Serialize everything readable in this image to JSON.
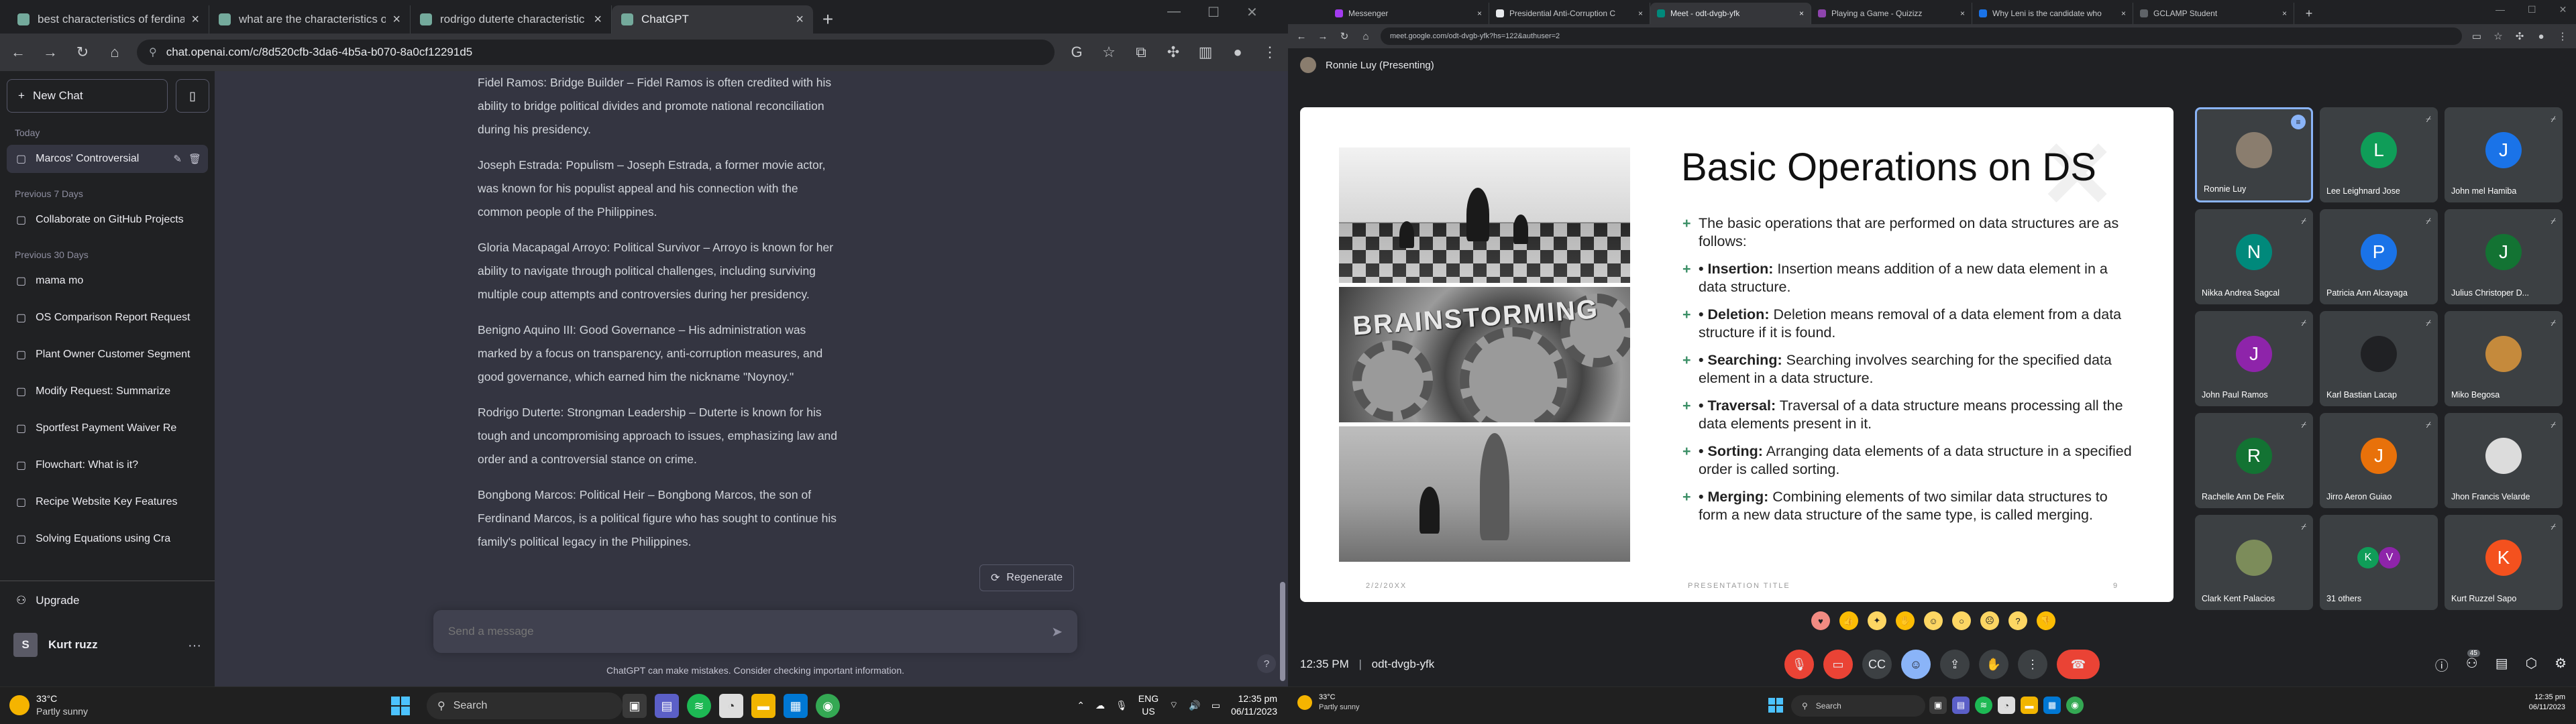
{
  "left_browser": {
    "tabs": [
      {
        "title": "best characteristics of ferdinan",
        "color": "#74aa9c"
      },
      {
        "title": "what are the characteristics of",
        "color": "#74aa9c"
      },
      {
        "title": "rodrigo duterte characteristic",
        "color": "#74aa9c"
      },
      {
        "title": "ChatGPT",
        "color": "#74aa9c"
      }
    ],
    "url": "chat.openai.com/c/8d520cfb-3da6-4b5a-b070-8a0cf12291d5"
  },
  "chatgpt": {
    "new_chat": "New Chat",
    "sections": [
      {
        "label": "Today",
        "items": [
          "Marcos' Controversial"
        ]
      },
      {
        "label": "Previous 7 Days",
        "items": [
          "Collaborate on GitHub Projects"
        ]
      },
      {
        "label": "Previous 30 Days",
        "items": [
          "mama mo",
          "OS Comparison Report Request",
          "Plant Owner Customer Segment",
          "Modify Request: Summarize",
          "Sportfest Payment Waiver Re",
          "Flowchart: What is it?",
          "Recipe Website Key Features",
          "Solving Equations using Cra"
        ]
      }
    ],
    "upgrade": "Upgrade",
    "user_initial": "S",
    "user_name": "Kurt ruzz",
    "messages": [
      "Fidel Ramos: Bridge Builder – Fidel Ramos is often credited with his ability to bridge political divides and promote national reconciliation during his presidency.",
      "Joseph Estrada: Populism – Joseph Estrada, a former movie actor, was known for his populist appeal and his connection with the common people of the Philippines.",
      "Gloria Macapagal Arroyo: Political Survivor – Arroyo is known for her ability to navigate through political challenges, including surviving multiple coup attempts and controversies during her presidency.",
      "Benigno Aquino III: Good Governance – His administration was marked by a focus on transparency, anti-corruption measures, and good governance, which earned him the nickname \"Noynoy.\"",
      "Rodrigo Duterte: Strongman Leadership – Duterte is known for his tough and uncompromising approach to issues, emphasizing law and order and a controversial stance on crime.",
      "Bongbong Marcos: Political Heir – Bongbong Marcos, the son of Ferdinand Marcos, is a political figure who has sought to continue his family's political legacy in the Philippines."
    ],
    "regenerate": "Regenerate",
    "input_placeholder": "Send a message",
    "disclaimer": "ChatGPT can make mistakes. Consider checking important information.",
    "help": "?"
  },
  "left_taskbar": {
    "temp": "33°C",
    "weather": "Partly sunny",
    "search": "Search",
    "lang1": "ENG",
    "lang2": "US",
    "time": "12:35 pm",
    "date": "06/11/2023"
  },
  "right_browser": {
    "tabs": [
      {
        "title": "Messenger",
        "color": "#a33bf0"
      },
      {
        "title": "Presidential Anti-Corruption C",
        "color": "#e8eaed"
      },
      {
        "title": "Meet - odt-dvgb-yfk",
        "color": "#00897b"
      },
      {
        "title": "Playing a Game - Quizizz",
        "color": "#8e44ad"
      },
      {
        "title": "Why Leni is the candidate who",
        "color": "#1a73e8"
      },
      {
        "title": "GCLAMP Student",
        "color": "#5f6368"
      }
    ],
    "url": "meet.google.com/odt-dvgb-yfk?hs=122&authuser=2"
  },
  "meet": {
    "presenter_label": "Ronnie Luy (Presenting)",
    "slide": {
      "title": "Basic Operations on DS",
      "bullets": [
        {
          "term": "",
          "text": "The basic operations that are performed on data structures are as follows:"
        },
        {
          "term": "• Insertion:",
          "text": " Insertion means addition of a new data element in a data structure."
        },
        {
          "term": "• Deletion:",
          "text": " Deletion means removal of a data element from a data structure if it is found."
        },
        {
          "term": "• Searching:",
          "text": " Searching involves searching for the specified data element in a data structure."
        },
        {
          "term": "• Traversal:",
          "text": " Traversal of a data structure means processing all the data elements present in it."
        },
        {
          "term": "• Sorting:",
          "text": " Arranging data elements of a data structure in a specified order is called sorting."
        },
        {
          "term": "• Merging:",
          "text": " Combining elements of two similar data structures to form a new data structure of the same type, is called merging."
        }
      ],
      "image_word": "BRAINSTORMING",
      "footer_date": "2/2/20XX",
      "footer_title": "PRESENTATION TITLE",
      "footer_page": "9"
    },
    "participants": [
      {
        "name": "Ronnie Luy",
        "initial": "",
        "color": "#8a7d6e",
        "photo": true,
        "active": true
      },
      {
        "name": "Lee Leighnard Jose",
        "initial": "L",
        "color": "#0f9d58"
      },
      {
        "name": "John mel Hamiba",
        "initial": "J",
        "color": "#1a73e8"
      },
      {
        "name": "Nikka Andrea Sagcal",
        "initial": "N",
        "color": "#00897b"
      },
      {
        "name": "Patricia Ann Alcayaga",
        "initial": "P",
        "color": "#1a73e8"
      },
      {
        "name": "Julius Christoper D...",
        "initial": "J",
        "color": "#137333"
      },
      {
        "name": "John Paul Ramos",
        "initial": "J",
        "color": "#8e24aa"
      },
      {
        "name": "Karl Bastian Lacap",
        "initial": "",
        "color": "#202124",
        "photo": true
      },
      {
        "name": "Miko Begosa",
        "initial": "",
        "color": "#c58a3c",
        "photo": true
      },
      {
        "name": "Rachelle Ann De Felix",
        "initial": "R",
        "color": "#137333"
      },
      {
        "name": "Jirro Aeron Guiao",
        "initial": "J",
        "color": "#e8710a"
      },
      {
        "name": "Jhon Francis Velarde",
        "initial": "",
        "color": "#dcdcdc",
        "photo": true
      },
      {
        "name": "Clark Kent Palacios",
        "initial": "",
        "color": "#7c8c5a",
        "photo": true
      },
      {
        "name": "31 others",
        "initial": "K",
        "color": "#0f9d58",
        "others": true
      },
      {
        "name": "Kurt Ruzzel Sapo",
        "initial": "K",
        "color": "#f4511e"
      }
    ],
    "time": "12:35 PM",
    "code": "odt-dvgb-yfk",
    "participant_count": "45"
  },
  "right_taskbar": {
    "temp": "33°C",
    "weather": "Partly sunny",
    "search": "Search",
    "time": "12:35 pm",
    "date": "06/11/2023"
  }
}
